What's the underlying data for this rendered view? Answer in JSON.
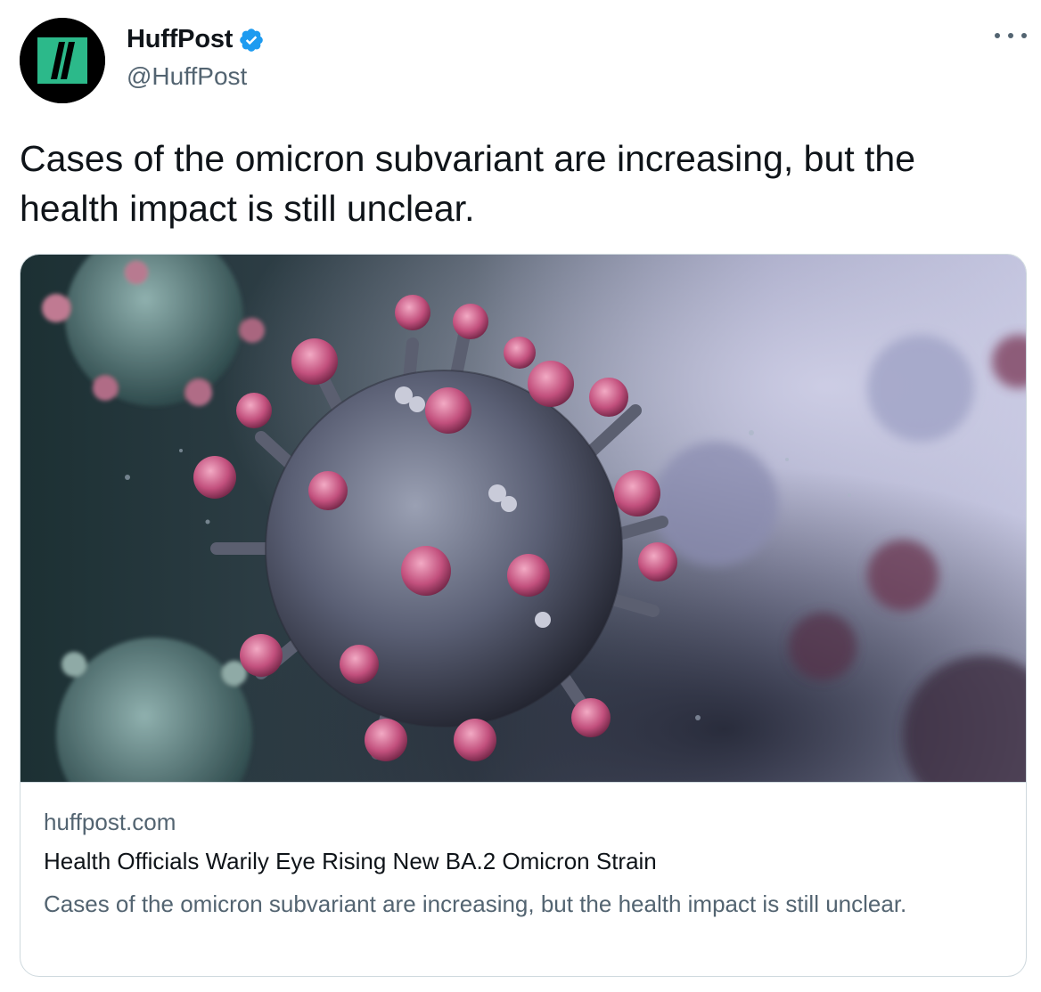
{
  "author": {
    "display_name": "HuffPost",
    "handle": "@HuffPost",
    "verified": true,
    "avatar_icon": "huffpost-logo-icon",
    "avatar_colors": {
      "background": "#000000",
      "mark": "#2cb98a"
    }
  },
  "tweet": {
    "text": "Cases of the omicron subvariant are increasing, but the health impact is still unclear."
  },
  "card": {
    "image_alt": "3D illustration of coronavirus particles",
    "domain": "huffpost.com",
    "title": "Health Officials Warily Eye Rising New BA.2 Omicron Strain",
    "description": "Cases of the omicron subvariant are increasing, but the health impact is still unclear."
  },
  "icons": {
    "verified": "verified-badge-icon",
    "more": "more-options-icon"
  },
  "colors": {
    "text_primary": "#0f1419",
    "text_secondary": "#536471",
    "border": "#cfd9de",
    "verified_blue": "#1d9bf0"
  }
}
